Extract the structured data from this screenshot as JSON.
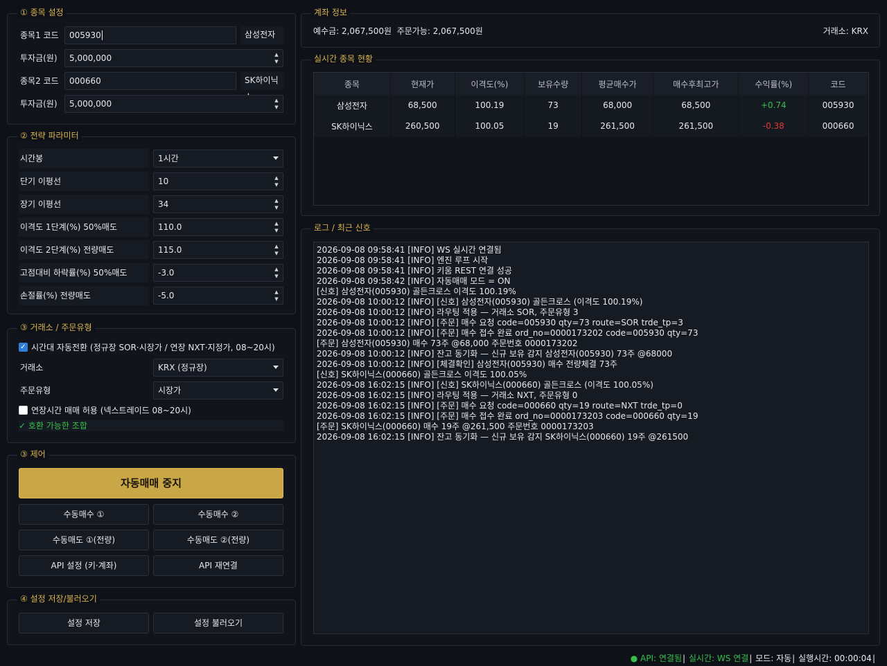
{
  "stock_settings": {
    "title": "① 종목 설정",
    "stock1_label": "종목1 코드",
    "stock1_code": "005930",
    "stock1_name": "삼성전자",
    "invest1_label": "투자금(원)",
    "invest1_value": "5,000,000",
    "stock2_label": "종목2 코드",
    "stock2_code": "000660",
    "stock2_name": "SK하이닉스",
    "invest2_label": "투자금(원)",
    "invest2_value": "5,000,000"
  },
  "strategy": {
    "title": "② 전략 파라미터",
    "timeframe_label": "시간봉",
    "timeframe_value": "1시간",
    "short_ma_label": "단기 이평선",
    "short_ma_value": "10",
    "long_ma_label": "장기 이평선",
    "long_ma_value": "34",
    "disp1_label": "이격도 1단계(%) 50%매도",
    "disp1_value": "110.0",
    "disp2_label": "이격도 2단계(%) 전량매도",
    "disp2_value": "115.0",
    "drop_label": "고점대비 하락률(%) 50%매도",
    "drop_value": "-3.0",
    "stoploss_label": "손절률(%) 전량매도",
    "stoploss_value": "-5.0"
  },
  "exchange": {
    "title": "③ 거래소 / 주문유형",
    "auto_switch_label": "시간대 자동전환 (정규장 SOR·시장가 / 연장 NXT·지정가, 08~20시)",
    "auto_switch_checked": true,
    "exchange_label": "거래소",
    "exchange_value": "KRX (정규장)",
    "order_type_label": "주문유형",
    "order_type_value": "시장가",
    "extended_label": "연장시간 매매 허용 (넥스트레이드 08~20시)",
    "extended_checked": false,
    "compat_text": "✓ 호환 가능한 조합"
  },
  "control": {
    "title": "③ 제어",
    "auto_stop": "자동매매 중지",
    "manual_buy1": "수동매수 ①",
    "manual_buy2": "수동매수 ②",
    "manual_sell1": "수동매도 ①(전량)",
    "manual_sell2": "수동매도 ②(전량)",
    "api_settings": "API 설정 (키·계좌)",
    "api_reconnect": "API 재연결"
  },
  "save_load": {
    "title": "④ 설정 저장/불러오기",
    "save": "설정 저장",
    "load": "설정 불러오기"
  },
  "account": {
    "title": "계좌 정보",
    "deposit_text": "예수금: 2,067,500원  주문가능: 2,067,500원",
    "exchange_text": "거래소: KRX"
  },
  "positions": {
    "title": "실시간 종목 현황",
    "headers": [
      "종목",
      "현재가",
      "이격도(%)",
      "보유수량",
      "평균매수가",
      "매수후최고가",
      "수익률(%)",
      "코드"
    ],
    "rows": [
      [
        "삼성전자",
        "68,500",
        "100.19",
        "73",
        "68,000",
        "68,500",
        "+0.74",
        "005930"
      ],
      [
        "SK하이닉스",
        "260,500",
        "100.05",
        "19",
        "261,500",
        "261,500",
        "-0.38",
        "000660"
      ]
    ],
    "colors": {
      "up": "#35c04a",
      "down": "#e03b3b"
    }
  },
  "log": {
    "title": "로그 / 최근 신호",
    "lines": [
      "2026-09-08 09:58:41 [INFO] WS 실시간 연결됨",
      "2026-09-08 09:58:41 [INFO] 엔진 루프 시작",
      "2026-09-08 09:58:41 [INFO] 키움 REST 연결 성공",
      "2026-09-08 09:58:42 [INFO] 자동매매 모드 = ON",
      "[신호] 삼성전자(005930) 골든크로스 이격도 100.19%",
      "2026-09-08 10:00:12 [INFO] [신호] 삼성전자(005930) 골든크로스 (이격도 100.19%)",
      "2026-09-08 10:00:12 [INFO] 라우팅 적용 — 거래소 SOR, 주문유형 3",
      "2026-09-08 10:00:12 [INFO] [주문] 매수 요청 code=005930 qty=73 route=SOR trde_tp=3",
      "2026-09-08 10:00:12 [INFO] [주문] 매수 접수 완료 ord_no=0000173202 code=005930 qty=73",
      "[주문] 삼성전자(005930) 매수 73주 @68,000 주문번호 0000173202",
      "2026-09-08 10:00:12 [INFO] 잔고 동기화 — 신규 보유 감지 삼성전자(005930) 73주 @68000",
      "2026-09-08 10:00:12 [INFO] [체결확인] 삼성전자(005930) 매수 전량체결 73주",
      "[신호] SK하이닉스(000660) 골든크로스 이격도 100.05%",
      "2026-09-08 16:02:15 [INFO] [신호] SK하이닉스(000660) 골든크로스 (이격도 100.05%)",
      "2026-09-08 16:02:15 [INFO] 라우팅 적용 — 거래소 NXT, 주문유형 0",
      "2026-09-08 16:02:15 [INFO] [주문] 매수 요청 code=000660 qty=19 route=NXT trde_tp=0",
      "2026-09-08 16:02:15 [INFO] [주문] 매수 접수 완료 ord_no=0000173203 code=000660 qty=19",
      "[주문] SK하이닉스(000660) 매수 19주 @261,500 주문번호 0000173203",
      "2026-09-08 16:02:15 [INFO] 잔고 동기화 — 신규 보유 감지 SK하이닉스(000660) 19주 @261500"
    ]
  },
  "status": {
    "api": "● API: 연결됨",
    "realtime": "실시간: WS 연결",
    "mode": "모드: 자동",
    "runtime": "실행시간: 00:00:04",
    "colors": {
      "api": "#35c04a",
      "realtime": "#35c04a"
    }
  }
}
